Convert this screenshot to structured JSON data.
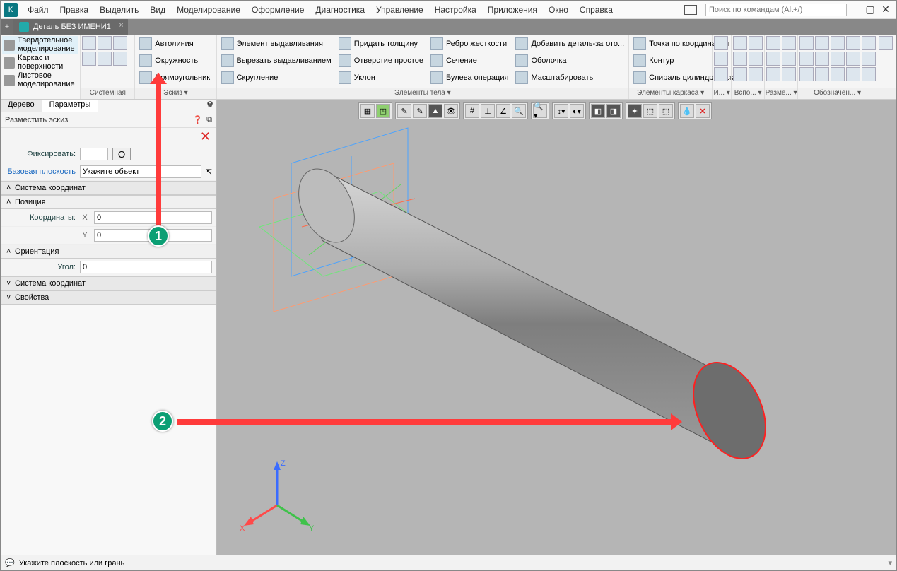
{
  "menu": {
    "file": "Файл",
    "edit": "Правка",
    "select": "Выделить",
    "view": "Вид",
    "modeling": "Моделирование",
    "design": "Оформление",
    "diag": "Диагностика",
    "manage": "Управление",
    "settings": "Настройка",
    "apps": "Приложения",
    "window": "Окно",
    "help": "Справка",
    "search_placeholder": "Поиск по командам (Alt+/)"
  },
  "tab": {
    "title": "Деталь БЕЗ ИМЕНИ1"
  },
  "modes": {
    "solid": "Твердотельное моделирование",
    "frame": "Каркас и поверхности",
    "sheet": "Листовое моделирование"
  },
  "ribbon": {
    "group_system": "Системная",
    "group_sketch": "Эскиз ▾",
    "group_body": "Элементы тела ▾",
    "group_frame": "Элементы каркаса ▾",
    "group_i": "И... ▾",
    "group_vsp": "Вспо... ▾",
    "group_razm": "Разме... ▾",
    "group_oboz": "Обозначен... ▾",
    "autoline": "Автолиния",
    "circle": "Окружность",
    "rect": "Прямоугольник",
    "extrude": "Элемент выдавливания",
    "cut": "Вырезать выдавливанием",
    "fillet": "Скругление",
    "thick": "Придать толщину",
    "hole": "Отверстие простое",
    "draft": "Уклон",
    "rib": "Ребро жесткости",
    "section": "Сечение",
    "bool": "Булева операция",
    "addpart": "Добавить деталь-загото...",
    "shell": "Оболочка",
    "scale": "Масштабировать",
    "pointcoord": "Точка по координатам",
    "contour": "Контур",
    "spiral": "Спираль цилиндрическ..."
  },
  "panel": {
    "tab_tree": "Дерево",
    "tab_params": "Параметры",
    "place_sketch": "Разместить эскиз",
    "fix": "Фиксировать:",
    "fix_btn": "О",
    "base_plane": "Базовая плоскость",
    "base_plane_val": "Укажите объект",
    "sec_coord": "Система координат",
    "sec_pos": "Позиция",
    "coords": "Координаты:",
    "x": "X",
    "y": "Y",
    "xval": "0",
    "yval": "0",
    "sec_orient": "Ориентация",
    "angle": "Угол:",
    "angleval": "0",
    "sec_coord2": "Система координат",
    "sec_props": "Свойства"
  },
  "status": {
    "msg": "Укажите плоскость или грань"
  },
  "axis": {
    "x": "X",
    "y": "Y",
    "z": "Z"
  },
  "annot": {
    "a1": "1",
    "a2": "2"
  }
}
